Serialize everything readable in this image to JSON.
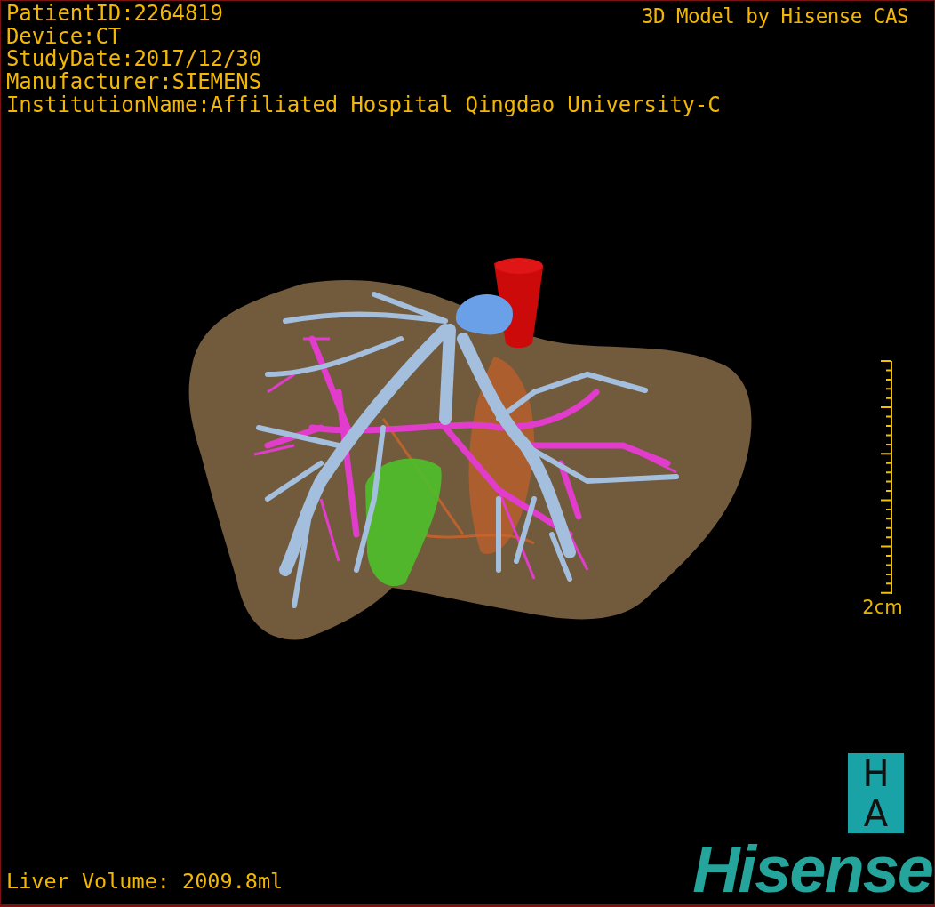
{
  "viewer": {
    "info_lines": [
      "PatientID:2264819",
      "Device:CT",
      "StudyDate:2017/12/30",
      "Manufacturer:SIEMENS",
      "InstitutionName:Affiliated Hospital Qingdao University-C"
    ],
    "title": "3D Model by Hisense CAS",
    "scale_bar": {
      "label": "2cm"
    },
    "measurement": "Liver Volume: 2009.8ml",
    "orientation_marker": [
      "H",
      "A"
    ],
    "logo": "Hisense"
  }
}
